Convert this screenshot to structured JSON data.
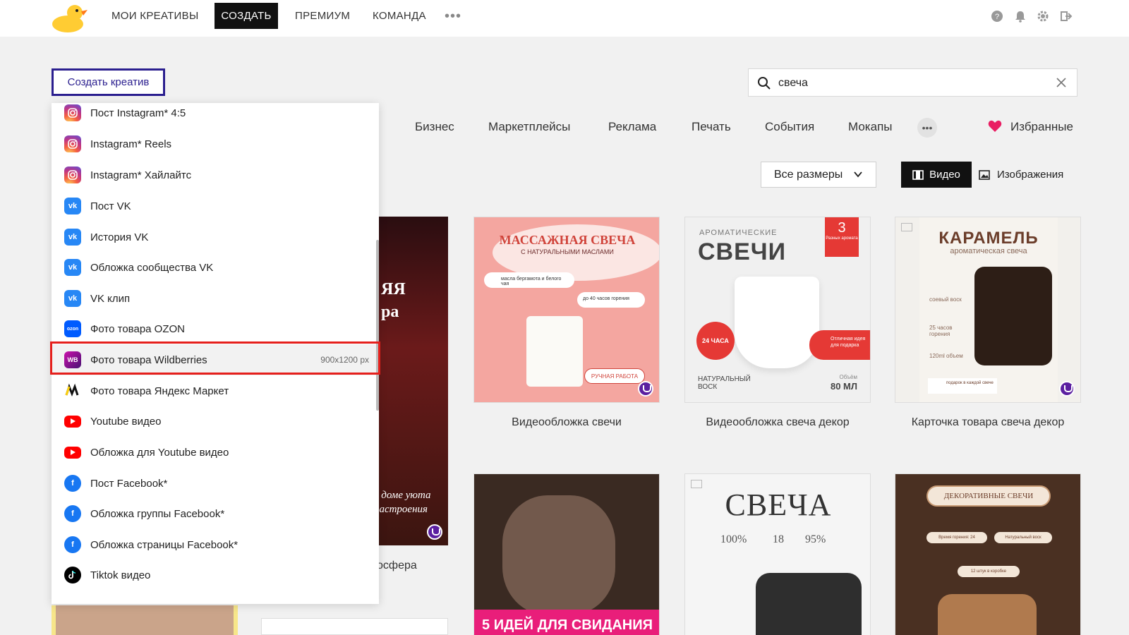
{
  "nav": {
    "items": [
      "МОИ КРЕАТИВЫ",
      "СОЗДАТЬ",
      "ПРЕМИУМ",
      "КОМАНДА"
    ],
    "more": "•••"
  },
  "create_button": "Создать креатив",
  "search": {
    "value": "свеча"
  },
  "categories": [
    "Бизнес",
    "Маркетплейсы",
    "Реклама",
    "Печать",
    "События",
    "Мокапы"
  ],
  "categories_more": "•••",
  "favorites": "Избранные",
  "filters": {
    "sizes": "Все размеры",
    "video": "Видео",
    "images": "Изображения"
  },
  "dropdown": {
    "items": [
      {
        "label": "Пост Instagram* 4:5",
        "icon": "instagram-icon"
      },
      {
        "label": "Instagram* Reels",
        "icon": "instagram-icon"
      },
      {
        "label": "Instagram* Хайлайтс",
        "icon": "instagram-icon"
      },
      {
        "label": "Пост VK",
        "icon": "vk-icon"
      },
      {
        "label": "История VK",
        "icon": "vk-icon"
      },
      {
        "label": "Обложка сообщества VK",
        "icon": "vk-icon"
      },
      {
        "label": "VK клип",
        "icon": "vk-icon"
      },
      {
        "label": "Фото товара OZON",
        "icon": "ozon-icon"
      },
      {
        "label": "Фото товара Wildberries",
        "icon": "wildberries-icon",
        "size": "900x1200 px"
      },
      {
        "label": "Фото товара Яндекс Маркет",
        "icon": "yandex-market-icon"
      },
      {
        "label": "Youtube видео",
        "icon": "youtube-icon"
      },
      {
        "label": "Обложка для Youtube видео",
        "icon": "youtube-icon"
      },
      {
        "label": "Пост Facebook*",
        "icon": "facebook-icon"
      },
      {
        "label": "Обложка группы Facebook*",
        "icon": "facebook-icon"
      },
      {
        "label": "Обложка страницы Facebook*",
        "icon": "facebook-icon"
      },
      {
        "label": "Tiktok видео",
        "icon": "tiktok-icon"
      }
    ]
  },
  "cards": [
    {
      "title": "Видеообложка свечи",
      "text": {
        "headline": "МАССАЖНАЯ СВЕЧА",
        "sub": "С НАТУРАЛЬНЫМИ МАСЛАМИ",
        "note1": "масла бергамота и белого чая",
        "note2": "до 40 часов горения",
        "note3": "РУЧНАЯ РАБОТА"
      }
    },
    {
      "title": "Видеообложка свеча декор",
      "text": {
        "top": "АРОМАТИЧЕСКИЕ",
        "headline": "СВЕЧИ",
        "ribbon": "3",
        "ribbon_sub": "Разных аромата",
        "seal": "24 ЧАСА",
        "gift": "Отличная идея для подарка",
        "bottom_left": "НАТУРАЛЬНЫЙ ВОСК",
        "bottom_right_label": "Объём",
        "bottom_right": "80 МЛ"
      }
    },
    {
      "title": "Карточка товара свеча декор",
      "text": {
        "headline": "КАРАМЕЛЬ",
        "sub": "ароматическая свеча",
        "f1": "соевый воск",
        "f2": "25 часов горения",
        "f3": "120ml объем",
        "gift": "подарок в каждой свече"
      }
    },
    {
      "text": {
        "banner": "5 ИДЕЙ ДЛЯ СВИДАНИЯ"
      }
    },
    {
      "text": {
        "headline": "СВЕЧА",
        "s1": "100%",
        "s2": "18",
        "s3": "95%"
      }
    },
    {
      "text": {
        "headline": "ДЕКОРАТИВНЫЕ СВЕЧИ",
        "p1": "Время горения: 24",
        "p2": "Натуральный воск",
        "p3": "12 штук в коробке"
      }
    }
  ],
  "partial_card": {
    "title": "осфера",
    "text1": "ЯЯ",
    "text2": "ра",
    "caption": "в доме уюта настроения"
  },
  "colors": {
    "accent": "#2b1f8f",
    "highlight": "#e5201c",
    "favorite": "#e91e63"
  }
}
